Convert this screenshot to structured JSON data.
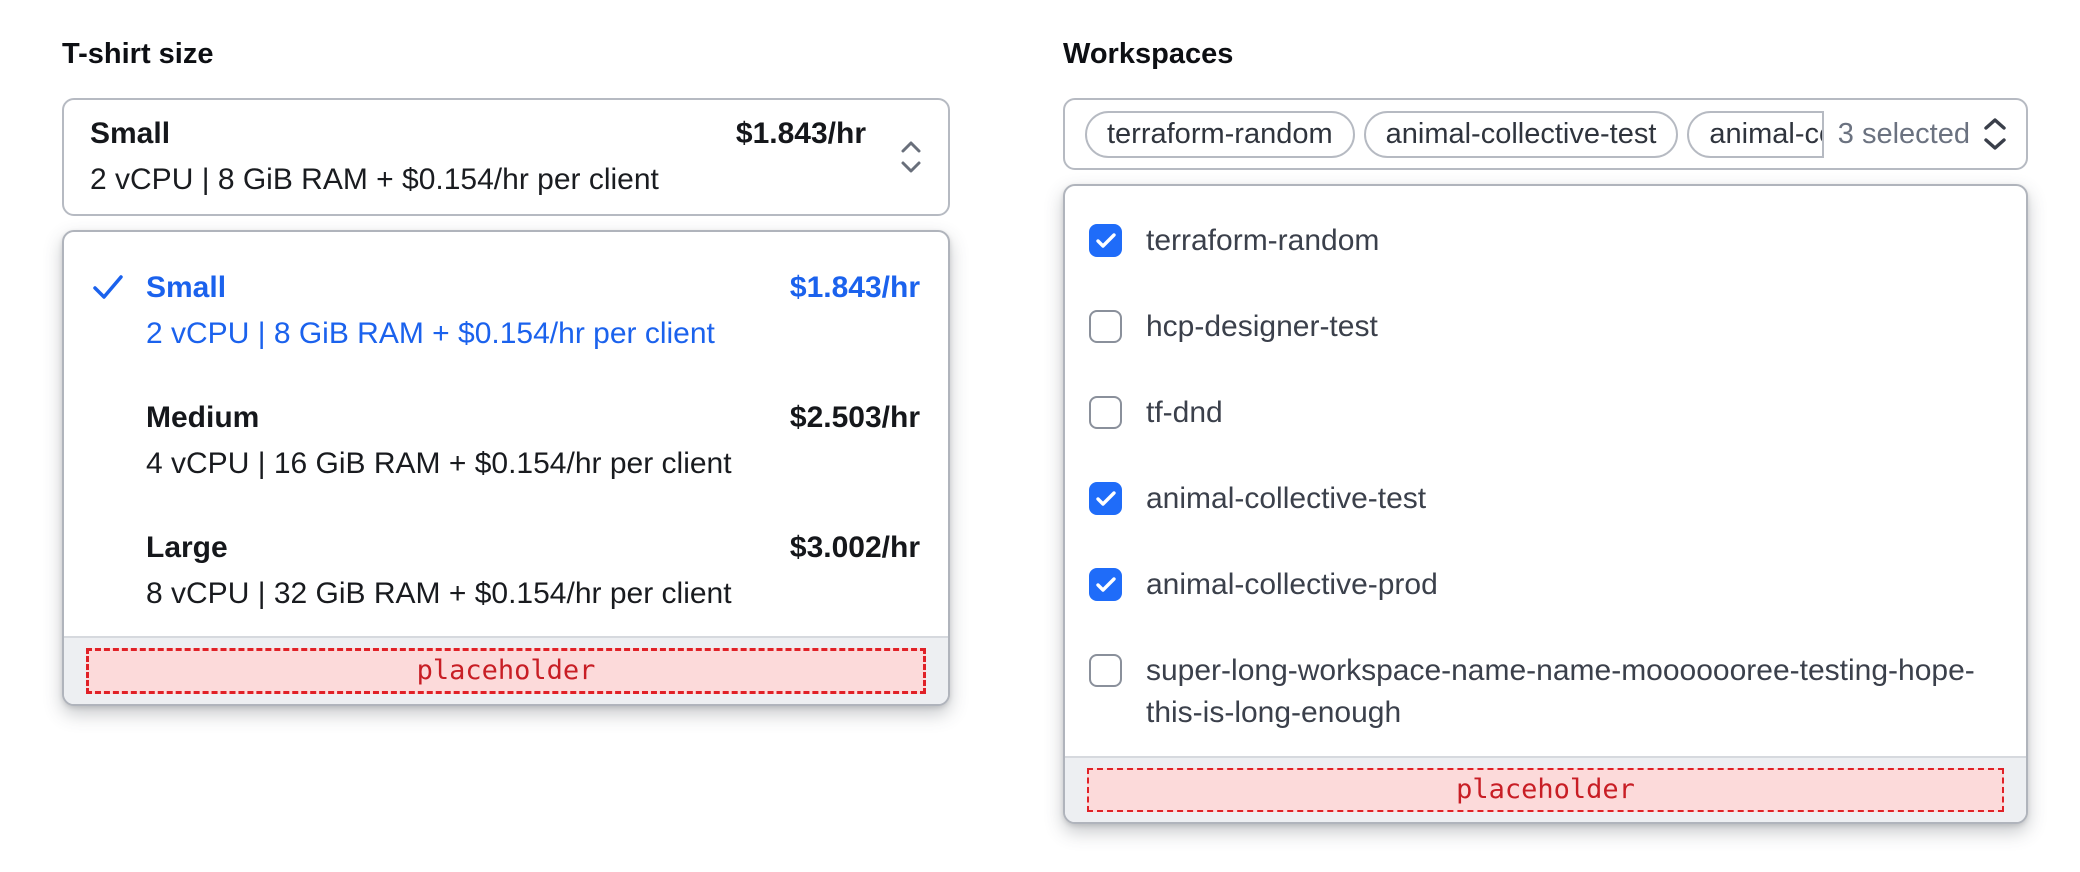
{
  "colors": {
    "accent_blue": "#1b62ed",
    "checkbox_blue": "#1f6cf9",
    "placeholder_red": "#c81e25",
    "placeholder_bg": "#fcdada",
    "border_gray": "#b6bac2",
    "footer_bg": "#edeff2",
    "muted_text": "#6b7280"
  },
  "tshirt": {
    "label": "T-shirt size",
    "trigger": {
      "title": "Small",
      "subtitle": "2 vCPU | 8 GiB RAM + $0.154/hr per client",
      "price": "$1.843/hr"
    },
    "options": [
      {
        "title": "Small",
        "subtitle": "2 vCPU | 8 GiB RAM + $0.154/hr per client",
        "price": "$1.843/hr",
        "selected": true
      },
      {
        "title": "Medium",
        "subtitle": "4 vCPU | 16 GiB RAM + $0.154/hr per client",
        "price": "$2.503/hr",
        "selected": false
      },
      {
        "title": "Large",
        "subtitle": "8 vCPU | 32 GiB RAM + $0.154/hr per client",
        "price": "$3.002/hr",
        "selected": false
      }
    ],
    "footer_placeholder": "placeholder"
  },
  "workspaces": {
    "label": "Workspaces",
    "tags": [
      {
        "label": "terraform-random",
        "truncated": false
      },
      {
        "label": "animal-collective-test",
        "truncated": false
      },
      {
        "label": "animal-co",
        "truncated": true
      }
    ],
    "selected_count_label": "3 selected",
    "options": [
      {
        "label": "terraform-random",
        "checked": true
      },
      {
        "label": "hcp-designer-test",
        "checked": false
      },
      {
        "label": "tf-dnd",
        "checked": false
      },
      {
        "label": "animal-collective-test",
        "checked": true
      },
      {
        "label": "animal-collective-prod",
        "checked": true
      },
      {
        "label": "super-long-workspace-name-name-mooooooree-testing-hope-this-is-long-enough",
        "checked": false
      }
    ],
    "footer_placeholder": "placeholder"
  }
}
